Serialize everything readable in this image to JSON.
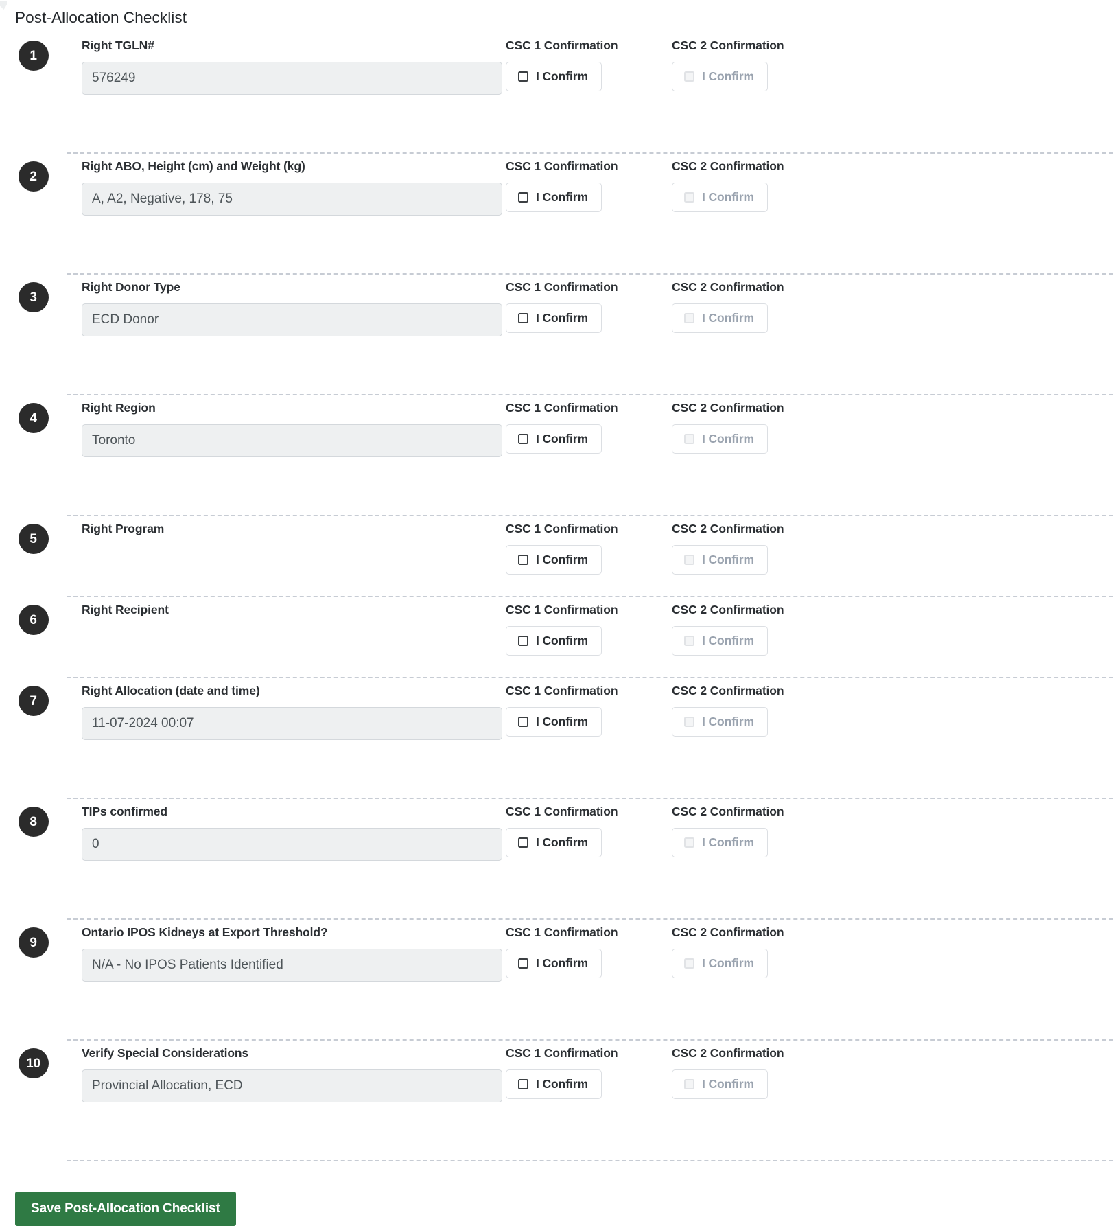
{
  "section": {
    "title": "Post-Allocation Checklist"
  },
  "columns": {
    "csc1_header": "CSC 1 Confirmation",
    "csc2_header": "CSC 2 Confirmation",
    "confirm_label": "I Confirm"
  },
  "colors": {
    "badge_bg": "#2b2b2b",
    "save_button_bg": "#2f7a44",
    "input_bg": "#eef0f1",
    "divider": "#c7ccd4",
    "disabled_text": "#9aa3af"
  },
  "items": [
    {
      "number": "1",
      "label": "Right TGLN#",
      "value": "576249",
      "has_input": true,
      "csc1": {
        "label": "I Confirm",
        "header": "CSC 1 Confirmation",
        "checked": false,
        "disabled": false
      },
      "csc2": {
        "label": "I Confirm",
        "header": "CSC 2 Confirmation",
        "checked": false,
        "disabled": true
      }
    },
    {
      "number": "2",
      "label": "Right ABO, Height (cm) and Weight (kg)",
      "value": "A, A2, Negative, 178, 75",
      "has_input": true,
      "csc1": {
        "label": "I Confirm",
        "header": "CSC 1 Confirmation",
        "checked": false,
        "disabled": false
      },
      "csc2": {
        "label": "I Confirm",
        "header": "CSC 2 Confirmation",
        "checked": false,
        "disabled": true
      }
    },
    {
      "number": "3",
      "label": "Right Donor Type",
      "value": "ECD Donor",
      "has_input": true,
      "csc1": {
        "label": "I Confirm",
        "header": "CSC 1 Confirmation",
        "checked": false,
        "disabled": false
      },
      "csc2": {
        "label": "I Confirm",
        "header": "CSC 2 Confirmation",
        "checked": false,
        "disabled": true
      }
    },
    {
      "number": "4",
      "label": "Right Region",
      "value": "Toronto",
      "has_input": true,
      "csc1": {
        "label": "I Confirm",
        "header": "CSC 1 Confirmation",
        "checked": false,
        "disabled": false
      },
      "csc2": {
        "label": "I Confirm",
        "header": "CSC 2 Confirmation",
        "checked": false,
        "disabled": true
      }
    },
    {
      "number": "5",
      "label": "Right Program",
      "value": "",
      "has_input": false,
      "csc1": {
        "label": "I Confirm",
        "header": "CSC 1 Confirmation",
        "checked": false,
        "disabled": false
      },
      "csc2": {
        "label": "I Confirm",
        "header": "CSC 2 Confirmation",
        "checked": false,
        "disabled": true
      }
    },
    {
      "number": "6",
      "label": "Right Recipient",
      "value": "",
      "has_input": false,
      "csc1": {
        "label": "I Confirm",
        "header": "CSC 1 Confirmation",
        "checked": false,
        "disabled": false
      },
      "csc2": {
        "label": "I Confirm",
        "header": "CSC 2 Confirmation",
        "checked": false,
        "disabled": true
      }
    },
    {
      "number": "7",
      "label": "Right Allocation (date and time)",
      "value": "11-07-2024 00:07",
      "has_input": true,
      "csc1": {
        "label": "I Confirm",
        "header": "CSC 1 Confirmation",
        "checked": false,
        "disabled": false
      },
      "csc2": {
        "label": "I Confirm",
        "header": "CSC 2 Confirmation",
        "checked": false,
        "disabled": true
      }
    },
    {
      "number": "8",
      "label": "TIPs confirmed",
      "value": "0",
      "has_input": true,
      "csc1": {
        "label": "I Confirm",
        "header": "CSC 1 Confirmation",
        "checked": false,
        "disabled": false
      },
      "csc2": {
        "label": "I Confirm",
        "header": "CSC 2 Confirmation",
        "checked": false,
        "disabled": true
      }
    },
    {
      "number": "9",
      "label": "Ontario IPOS Kidneys at Export Threshold?",
      "value": "N/A - No IPOS Patients Identified",
      "has_input": true,
      "csc1": {
        "label": "I Confirm",
        "header": "CSC 1 Confirmation",
        "checked": false,
        "disabled": false
      },
      "csc2": {
        "label": "I Confirm",
        "header": "CSC 2 Confirmation",
        "checked": false,
        "disabled": true
      }
    },
    {
      "number": "10",
      "label": "Verify Special Considerations",
      "value": "Provincial Allocation, ECD",
      "has_input": true,
      "csc1": {
        "label": "I Confirm",
        "header": "CSC 1 Confirmation",
        "checked": false,
        "disabled": false
      },
      "csc2": {
        "label": "I Confirm",
        "header": "CSC 2 Confirmation",
        "checked": false,
        "disabled": true
      }
    }
  ],
  "footer": {
    "save_label": "Save Post-Allocation Checklist"
  }
}
